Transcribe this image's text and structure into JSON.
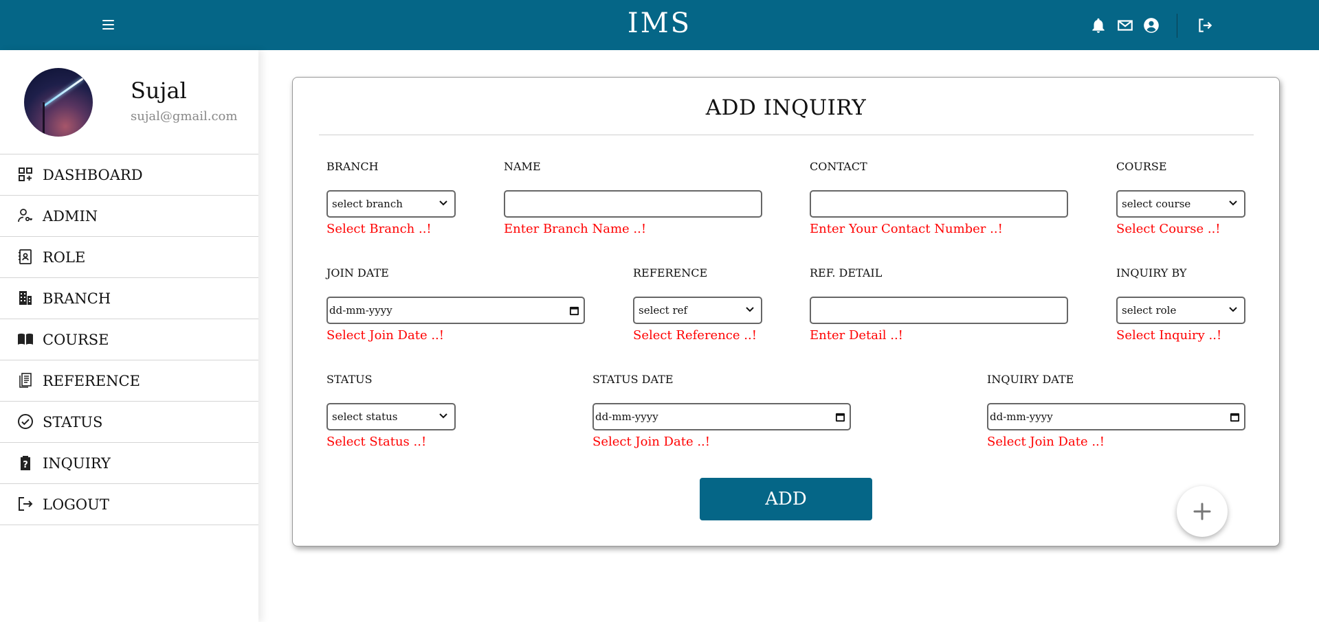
{
  "topbar": {
    "title": "IMS",
    "icons": [
      "menu-icon",
      "bell-icon",
      "mail-icon",
      "account-icon",
      "logout-icon"
    ]
  },
  "profile": {
    "name": "Sujal",
    "email": "sujal@gmail.com"
  },
  "sidebar": {
    "items": [
      {
        "label": "DASHBOARD",
        "icon": "dashboard-icon"
      },
      {
        "label": "ADMIN",
        "icon": "admin-icon"
      },
      {
        "label": "ROLE",
        "icon": "role-icon"
      },
      {
        "label": "BRANCH",
        "icon": "building-icon"
      },
      {
        "label": "COURSE",
        "icon": "book-icon"
      },
      {
        "label": "REFERENCE",
        "icon": "reference-icon"
      },
      {
        "label": "STATUS",
        "icon": "check-circle-icon"
      },
      {
        "label": "INQUIRY",
        "icon": "clipboard-question-icon"
      },
      {
        "label": "LOGOUT",
        "icon": "logout-icon"
      }
    ]
  },
  "form": {
    "title": "ADD INQUIRY",
    "branch": {
      "label": "BRANCH",
      "value": "select branch",
      "error": "Select Branch ..!"
    },
    "name": {
      "label": "NAME",
      "value": "",
      "error": "Enter Branch Name ..!"
    },
    "contact": {
      "label": "CONTACT",
      "value": "",
      "error": "Enter Your Contact Number ..!"
    },
    "course": {
      "label": "COURSE",
      "value": "select course",
      "error": "Select Course ..!"
    },
    "join_date": {
      "label": "JOIN DATE",
      "value": "dd-mm-yyyy",
      "error": "Select Join Date ..!"
    },
    "reference": {
      "label": "REFERENCE",
      "value": "select ref",
      "error": "Select Reference ..!"
    },
    "ref_detail": {
      "label": "REF. DETAIL",
      "value": "",
      "error": "Enter Detail ..!"
    },
    "inquiry_by": {
      "label": "INQUIRY BY",
      "value": "select role",
      "error": "Select Inquiry ..!"
    },
    "status": {
      "label": "STATUS",
      "value": "select status",
      "error": "Select Status ..!"
    },
    "status_date": {
      "label": "STATUS DATE",
      "value": "dd-mm-yyyy",
      "error": "Select Join Date ..!"
    },
    "inquiry_date": {
      "label": "INQUIRY DATE",
      "value": "dd-mm-yyyy",
      "error": "Select Join Date ..!"
    },
    "submit_label": "ADD"
  },
  "colors": {
    "brand": "#056687",
    "error": "#ff0000"
  }
}
